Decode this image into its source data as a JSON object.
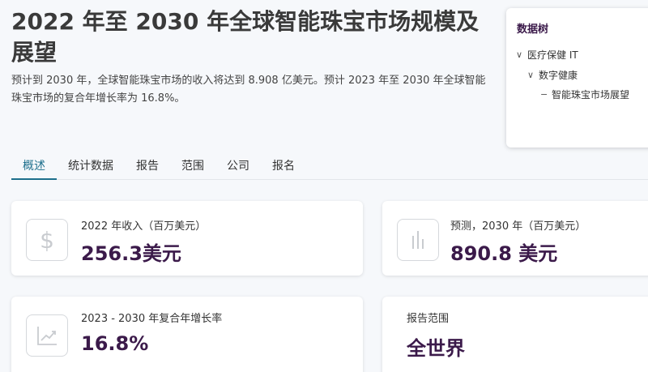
{
  "header": {
    "title": "2022 年至 2030 年全球智能珠宝市场规模及展望",
    "description": "预计到 2030 年，全球智能珠宝市场的收入将达到 8.908 亿美元。预计 2023 年至 2030 年全球智能珠宝市场的复合年增长率为 16.8%。"
  },
  "data_tree": {
    "title": "数据树",
    "nodes": [
      {
        "label": "医疗保健 IT",
        "glyph": "∨"
      },
      {
        "label": "数字健康",
        "glyph": "∨"
      },
      {
        "label": "智能珠宝市场展望",
        "glyph": "−"
      }
    ]
  },
  "tabs": [
    {
      "label": "概述",
      "active": true
    },
    {
      "label": "统计数据"
    },
    {
      "label": "报告"
    },
    {
      "label": "范围"
    },
    {
      "label": "公司"
    },
    {
      "label": "报名"
    }
  ],
  "cards": {
    "revenue_2022": {
      "label": "2022 年收入（百万美元）",
      "value": "256.3美元",
      "icon": "dollar-icon"
    },
    "forecast_2030": {
      "label": "预测，2030 年（百万美元）",
      "value": "890.8 美元",
      "icon": "bar-chart-icon"
    },
    "cagr": {
      "label": "2023 - 2030 年复合年增长率",
      "value": "16.8%",
      "icon": "trend-chart-icon"
    },
    "scope": {
      "label": "报告范围",
      "value": "全世界"
    }
  },
  "colors": {
    "accent": "#1d6f8c",
    "value": "#3b1a4a"
  }
}
